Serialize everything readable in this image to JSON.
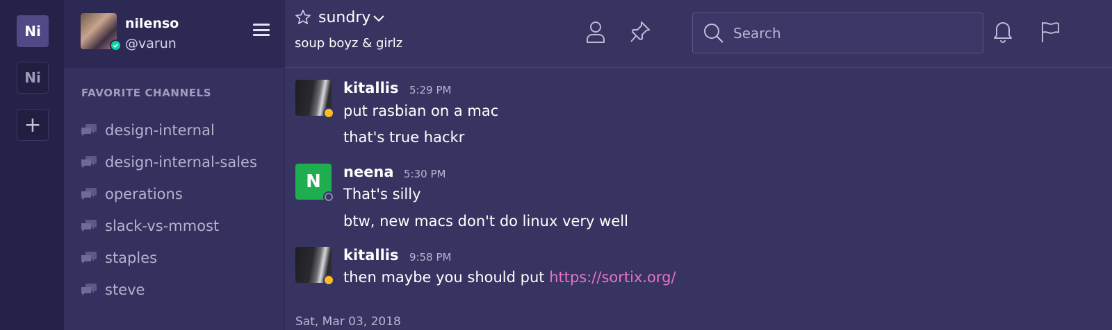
{
  "teams": {
    "active_label": "Ni",
    "other_label": "Ni",
    "add_label": "+"
  },
  "user": {
    "name": "nilenso",
    "handle": "@varun",
    "status": "online"
  },
  "sidebar": {
    "section_title": "FAVORITE CHANNELS",
    "channels": [
      {
        "label": "design-internal"
      },
      {
        "label": "design-internal-sales"
      },
      {
        "label": "operations"
      },
      {
        "label": "slack-vs-mmost"
      },
      {
        "label": "staples"
      },
      {
        "label": "steve"
      }
    ]
  },
  "channel": {
    "name": "sundry",
    "purpose": "soup boyz & girlz"
  },
  "search": {
    "placeholder": "Search"
  },
  "header_icons": [
    "member-icon",
    "pin-icon",
    "bell-icon",
    "flag-icon"
  ],
  "posts": [
    {
      "user": "kitallis",
      "time": "5:29 PM",
      "status": "away",
      "lines": [
        "put rasbian on a mac",
        "that's true hackr"
      ]
    },
    {
      "user": "neena",
      "avatar_letter": "N",
      "time": "5:30 PM",
      "status": "offline",
      "lines": [
        "That's silly",
        "btw, new macs don't do linux very well"
      ]
    },
    {
      "user": "kitallis",
      "time": "9:58 PM",
      "status": "away",
      "lines": [
        "then maybe you should put "
      ],
      "link": "https://sortix.org/"
    }
  ],
  "date_separator": "Sat, Mar 03, 2018",
  "colors": {
    "team_sidebar": "#25224a",
    "sidebar": "#35305e",
    "main_bg": "#383461",
    "online": "#06d6a0",
    "away": "#ffbc1f",
    "link": "#e673c6",
    "neena_avatar": "#1fae4f"
  }
}
